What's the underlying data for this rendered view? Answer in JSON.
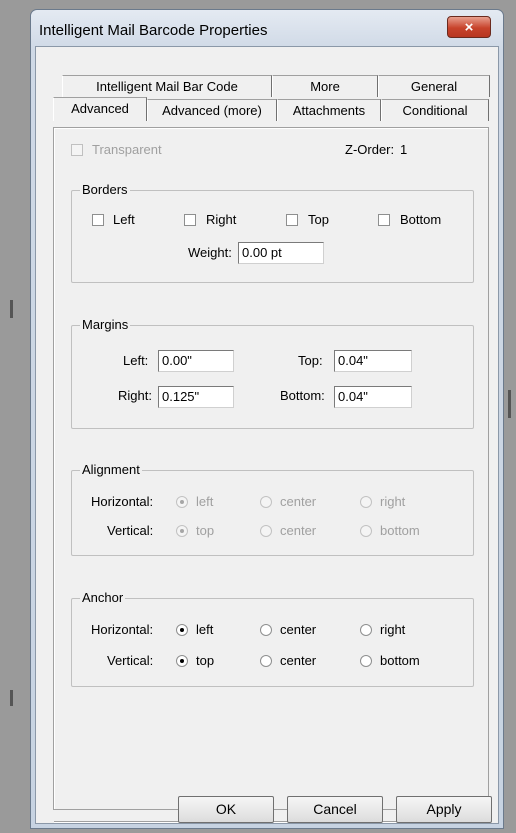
{
  "dialog": {
    "title": "Intelligent Mail Barcode Properties",
    "close_glyph": "×"
  },
  "tabs": {
    "row1": [
      "Intelligent Mail Bar Code",
      "More",
      "General"
    ],
    "row2": [
      "Advanced",
      "Advanced (more)",
      "Attachments",
      "Conditional"
    ],
    "active": "Advanced"
  },
  "advanced": {
    "transparent_label": "Transparent",
    "transparent_checked": false,
    "zorder_label": "Z-Order:",
    "zorder_value": "1",
    "borders": {
      "title": "Borders",
      "left": "Left",
      "right": "Right",
      "top": "Top",
      "bottom": "Bottom",
      "weight_label": "Weight:",
      "weight_value": "0.00 pt"
    },
    "margins": {
      "title": "Margins",
      "left_label": "Left:",
      "left_value": "0.00\"",
      "top_label": "Top:",
      "top_value": "0.04\"",
      "right_label": "Right:",
      "right_value": "0.125\"",
      "bottom_label": "Bottom:",
      "bottom_value": "0.04\""
    },
    "alignment": {
      "title": "Alignment",
      "horizontal_label": "Horizontal:",
      "vertical_label": "Vertical:",
      "h_options": [
        "left",
        "center",
        "right"
      ],
      "v_options": [
        "top",
        "center",
        "bottom"
      ],
      "h_selected": "left",
      "v_selected": "top",
      "enabled": false
    },
    "anchor": {
      "title": "Anchor",
      "horizontal_label": "Horizontal:",
      "vertical_label": "Vertical:",
      "h_options": [
        "left",
        "center",
        "right"
      ],
      "v_options": [
        "top",
        "center",
        "bottom"
      ],
      "h_selected": "left",
      "v_selected": "top",
      "enabled": true
    }
  },
  "buttons": {
    "ok": "OK",
    "cancel": "Cancel",
    "apply": "Apply"
  }
}
